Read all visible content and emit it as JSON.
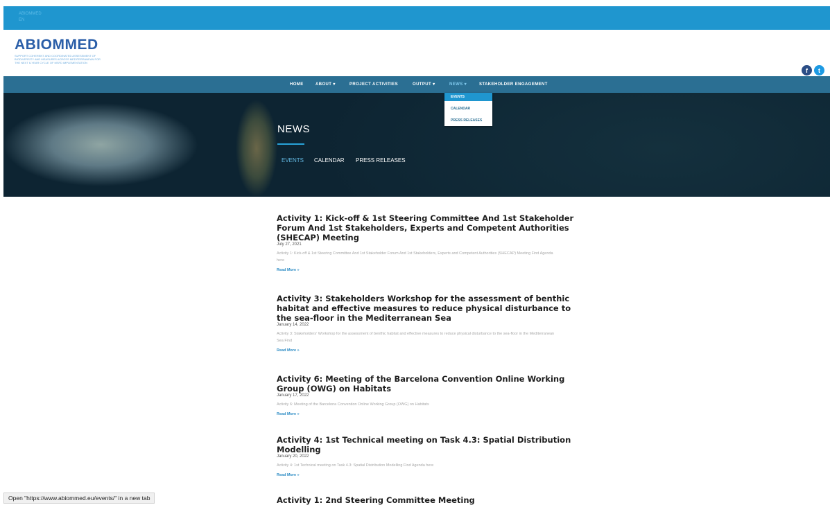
{
  "topbar": {
    "line1": "ABIOMMED",
    "line2": "EN"
  },
  "logo": {
    "wordmark": "ABIOMMED",
    "tagline": "SUPPORT COHERENT AND COORDINATED ASSESSMENT OF BIODIVERSITY AND MEASURES ACROSS MEDITERRANEAN FOR THE NEXT 6-YEAR CYCLE OF MSFD IMPLEMENTATION"
  },
  "social": {
    "facebook": "f",
    "twitter": "t"
  },
  "nav": {
    "home": "HOME",
    "about": "ABOUT ▾",
    "activities": "PROJECT ACTIVITIES",
    "output": "OUTPUT ▾",
    "news": "NEWS ▾",
    "stakeholder": "STAKEHOLDER ENGAGEMENT"
  },
  "dropdown": {
    "events": "EVENTS",
    "calendar": "CALENDAR",
    "press": "PRESS RELEASES"
  },
  "hero": {
    "title": "NEWS",
    "link_events": "EVENTS",
    "link_calendar": "CALENDAR",
    "link_press": "PRESS RELEASES"
  },
  "events": [
    {
      "title": "Activity 1: Kick-off & 1st Steering Committee And 1st Stakeholder Forum And 1st Stakeholders, Experts and Competent Authorities (SHECAP) Meeting",
      "date": "July 27, 2021",
      "excerpt": "Activity 1: Kick-off & 1st Steering Committee And 1st Stakeholder Forum And 1st Stakeholders, Experts and Competent Authorities (SHECAP) Meeting Find Agenda here",
      "more": "Read More »"
    },
    {
      "title": "Activity 3: Stakeholders Workshop for the assessment of benthic habitat and effective measures to reduce physical disturbance to the sea-floor in the Mediterranean Sea",
      "date": "January 14, 2022",
      "excerpt": "Activity 3: Stakeholders' Workshop for the assessment of benthic habitat and effective measures to reduce physical disturbance to the sea-floor in the Mediterranean Sea Find",
      "more": "Read More »"
    },
    {
      "title": "Activity 6: Meeting of the Barcelona Convention Online Working Group (OWG) on Habitats",
      "date": "January 17, 2022",
      "excerpt": "Activity 6: Meeting of the Barcelona Convention Online Working Group (OWG) on Habitats",
      "more": "Read More »"
    },
    {
      "title": "Activity 4: 1st Technical meeting on Task 4.3: Spatial Distribution Modelling",
      "date": "January 20, 2022",
      "excerpt": "Activity 4: 1st Technical meeting on Task 4.3: Spatial Distribution Modelling Find Agenda here",
      "more": "Read More »"
    },
    {
      "title": "Activity 1: 2nd Steering Committee Meeting"
    }
  ],
  "status": "Open \"https://www.abiommed.eu/events/\" in a new tab"
}
